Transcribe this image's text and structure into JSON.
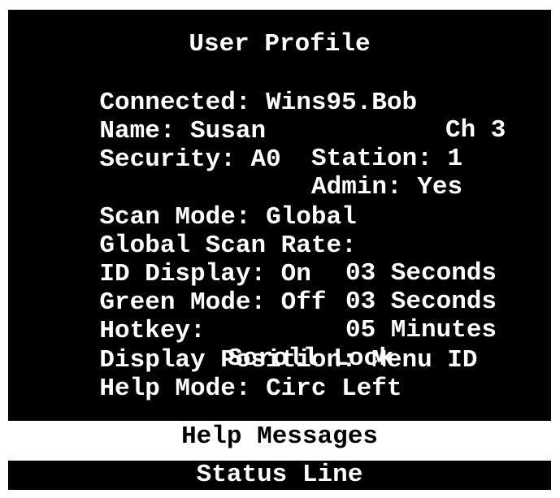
{
  "profile": {
    "title": "User Profile",
    "connected_label": "Connected:",
    "connected_value": "Wins95.Bob",
    "channel": "Ch 3",
    "name_label": "Name:",
    "name_value": "Susan",
    "station_label": "Station:",
    "station_value": "1",
    "security_label": "Security:",
    "security_value": "A0",
    "admin_label": "Admin:",
    "admin_value": "Yes",
    "scan_mode_label": "Scan Mode:",
    "scan_mode_value": "Global",
    "global_scan_rate_label": "Global Scan Rate:",
    "global_scan_rate_value": "03 Seconds",
    "id_display_label": "ID Display:",
    "id_display_value": "On",
    "id_display_time": "03 Seconds",
    "green_mode_label": "Green Mode:",
    "green_mode_value": "Off",
    "green_mode_time": "05 Minutes",
    "hotkey_label": "Hotkey:",
    "hotkey_value": "Scroll Lock",
    "display_position_label": "Display Position:",
    "display_position_value": "Menu ID",
    "help_mode_label": "Help Mode:",
    "help_mode_value": "Circ Left"
  },
  "help_messages": "Help Messages",
  "status_line": "Status Line"
}
